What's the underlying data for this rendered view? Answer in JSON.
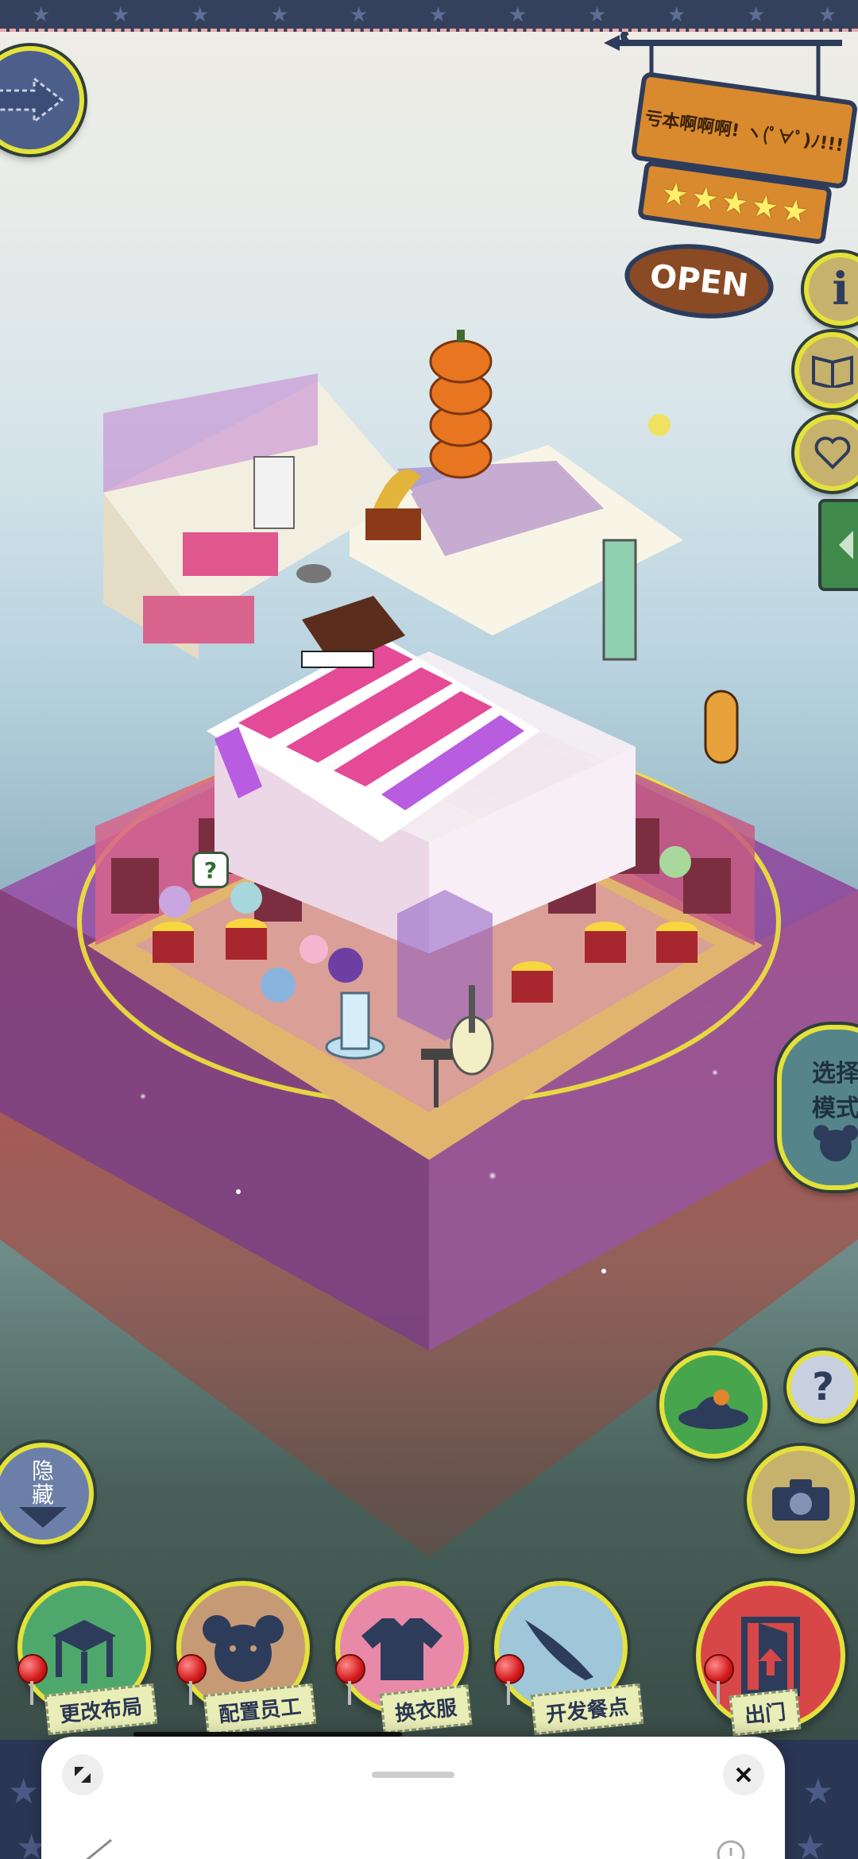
{
  "sign": {
    "shop_name": "亏本啊啊啊! ヽ(ﾟ∀ﾟ)ﾉ!!!",
    "stars": 5,
    "open_label": "OPEN"
  },
  "side_buttons": {
    "select_mode_line1": "选择",
    "select_mode_line2": "模式",
    "hide_line1": "隐",
    "hide_line2": "藏",
    "help_glyph": "?"
  },
  "bottom_menu": [
    {
      "label": "更改布局",
      "icon": "table-icon",
      "color": "#4fa86b"
    },
    {
      "label": "配置员工",
      "icon": "bear-icon",
      "color": "#c59a74"
    },
    {
      "label": "换衣服",
      "icon": "shirt-icon",
      "color": "#e889a8"
    },
    {
      "label": "开发餐点",
      "icon": "knife-icon",
      "color": "#9fc6d9"
    },
    {
      "label": "出门",
      "icon": "door-exit-icon",
      "color": "#d84747"
    }
  ],
  "thought_bubble": "?",
  "colors": {
    "accent_yellow": "#e4e23a",
    "sign_wood": "#d98a2e",
    "sign_border": "#2e3c5c",
    "badge_bg": "#e9eeb7"
  }
}
